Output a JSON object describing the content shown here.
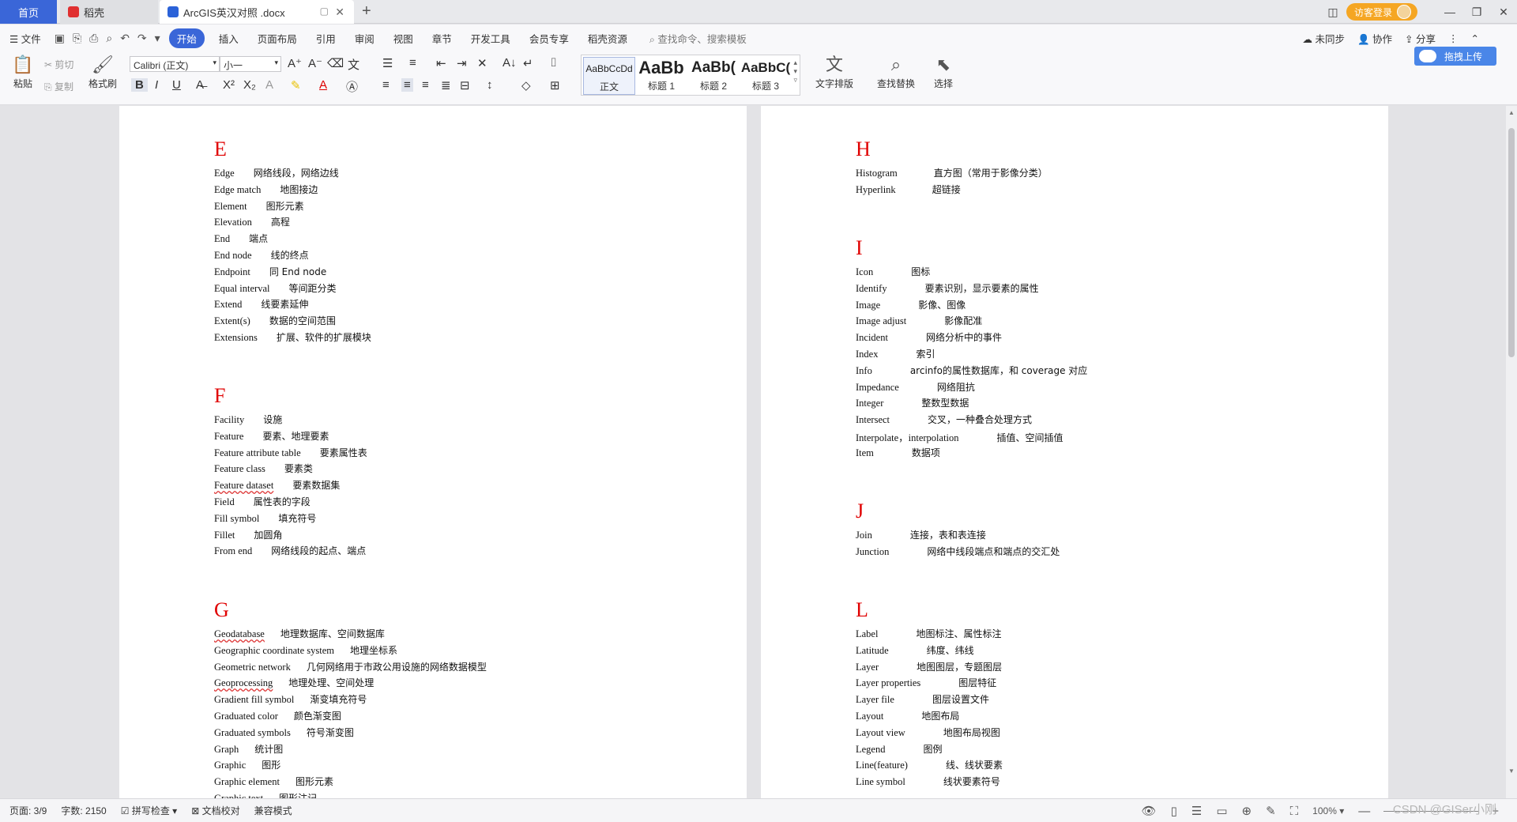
{
  "tabs": {
    "home": "首页",
    "daoke": "稻壳",
    "doc": "ArcGIS英汉对照 .docx"
  },
  "window": {
    "login": "访客登录"
  },
  "menu": {
    "file": "文件",
    "items": [
      "开始",
      "插入",
      "页面布局",
      "引用",
      "审阅",
      "视图",
      "章节",
      "开发工具",
      "会员专享",
      "稻壳资源"
    ],
    "search": "查找命令、搜索模板",
    "sync": "未同步",
    "collab": "协作",
    "share": "分享"
  },
  "ribbon": {
    "paste": "粘贴",
    "cut": "剪切",
    "copy": "复制",
    "format_painter": "格式刷",
    "font": "Calibri (正文)",
    "size": "小一",
    "styles": [
      {
        "preview": "AaBbCcDd",
        "label": "正文"
      },
      {
        "preview": "AaBb",
        "label": "标题 1"
      },
      {
        "preview": "AaBb(",
        "label": "标题 2"
      },
      {
        "preview": "AaBbC(",
        "label": "标题 3"
      }
    ],
    "text_layout": "文字排版",
    "find_replace": "查找替换",
    "select": "选择",
    "upload": "拖拽上传"
  },
  "page1": {
    "sections": [
      {
        "letter": "E",
        "entries": [
          {
            "en": "Edge",
            "zh": "网络线段，网络边线"
          },
          {
            "en": "Edge match",
            "zh": "地图接边"
          },
          {
            "en": "Element",
            "zh": "图形元素"
          },
          {
            "en": "Elevation",
            "zh": "高程"
          },
          {
            "en": "End",
            "zh": "端点"
          },
          {
            "en": "End node",
            "zh": "线的终点"
          },
          {
            "en": "Endpoint",
            "zh": "同 End node"
          },
          {
            "en": "Equal interval",
            "zh": "等间距分类"
          },
          {
            "en": "Extend",
            "zh": "线要素延伸"
          },
          {
            "en": "Extent(s)",
            "zh": "数据的空间范围"
          },
          {
            "en": "Extensions",
            "zh": "扩展、软件的扩展模块"
          }
        ]
      },
      {
        "letter": "F",
        "entries": [
          {
            "en": "Facility",
            "zh": "设施"
          },
          {
            "en": "Feature",
            "zh": "要素、地理要素"
          },
          {
            "en": "Feature attribute table",
            "zh": "要素属性表"
          },
          {
            "en": "Feature class",
            "zh": "要素类"
          },
          {
            "en": "Feature dataset",
            "zh": "要素数据集"
          },
          {
            "en": "Field",
            "zh": "属性表的字段"
          },
          {
            "en": "Fill symbol",
            "zh": "填充符号"
          },
          {
            "en": "Fillet",
            "zh": "加圆角"
          },
          {
            "en": "From end",
            "zh": "网络线段的起点、端点"
          }
        ]
      },
      {
        "letter": "G",
        "entries": [
          {
            "en": "Geodatabase",
            "zh": "地理数据库、空间数据库"
          },
          {
            "en": "Geographic coordinate system",
            "zh": "地理坐标系"
          },
          {
            "en": "Geometric network",
            "zh": "几何网络用于市政公用设施的网络数据模型"
          },
          {
            "en": "Geoprocessing",
            "zh": "地理处理、空间处理"
          },
          {
            "en": "Gradient fill symbol",
            "zh": "渐变填充符号"
          },
          {
            "en": "Graduated color",
            "zh": "颜色渐变图"
          },
          {
            "en": "Graduated symbols",
            "zh": "符号渐变图"
          },
          {
            "en": "Graph",
            "zh": "统计图"
          },
          {
            "en": "Graphic",
            "zh": "图形"
          },
          {
            "en": "Graphic element",
            "zh": "图形元素"
          },
          {
            "en": "Graphic text",
            "zh": "图形注记"
          }
        ]
      }
    ]
  },
  "page2": {
    "sections": [
      {
        "letter": "H",
        "entries": [
          {
            "en": "Histogram",
            "zh": "直方图（常用于影像分类）"
          },
          {
            "en": "Hyperlink",
            "zh": "超链接"
          }
        ]
      },
      {
        "letter": "I",
        "entries": [
          {
            "en": "Icon",
            "zh": "图标"
          },
          {
            "en": "Identify",
            "zh": "要素识别，显示要素的属性"
          },
          {
            "en": "Image",
            "zh": "影像、图像"
          },
          {
            "en": "Image adjust",
            "zh": "影像配准"
          },
          {
            "en": "Incident",
            "zh": "网络分析中的事件"
          },
          {
            "en": "Index",
            "zh": "索引"
          },
          {
            "en": "Info",
            "zh": "arcinfo的属性数据库，和 coverage 对应"
          },
          {
            "en": "Impedance",
            "zh": "网络阻抗"
          },
          {
            "en": "Integer",
            "zh": "整数型数据"
          },
          {
            "en": "Intersect",
            "zh": "交叉，一种叠合处理方式"
          },
          {
            "en": "Interpolate，interpolation",
            "zh": "插值、空间插值"
          },
          {
            "en": "Item",
            "zh": "数据项"
          }
        ]
      },
      {
        "letter": "J",
        "entries": [
          {
            "en": "Join",
            "zh": "连接，表和表连接"
          },
          {
            "en": "Junction",
            "zh": "网络中线段端点和端点的交汇处"
          }
        ]
      },
      {
        "letter": "L",
        "entries": [
          {
            "en": "Label",
            "zh": "地图标注、属性标注"
          },
          {
            "en": "Latitude",
            "zh": "纬度、纬线"
          },
          {
            "en": "Layer",
            "zh": "地图图层，专题图层"
          },
          {
            "en": "Layer properties",
            "zh": "图层特征"
          },
          {
            "en": "Layer file",
            "zh": "图层设置文件"
          },
          {
            "en": "Layout",
            "zh": "地图布局"
          },
          {
            "en": "Layout view",
            "zh": "地图布局视图"
          },
          {
            "en": "Legend",
            "zh": "图例"
          },
          {
            "en": "Line(feature)",
            "zh": "线、线状要素"
          },
          {
            "en": "Line symbol",
            "zh": "线状要素符号"
          }
        ]
      }
    ]
  },
  "status": {
    "page": "页面: 3/9",
    "words": "字数: 2150",
    "spell": "拼写检查",
    "proof": "文档校对",
    "compat": "兼容模式",
    "zoom": "100%",
    "watermark": "CSDN @GISer小刚"
  }
}
